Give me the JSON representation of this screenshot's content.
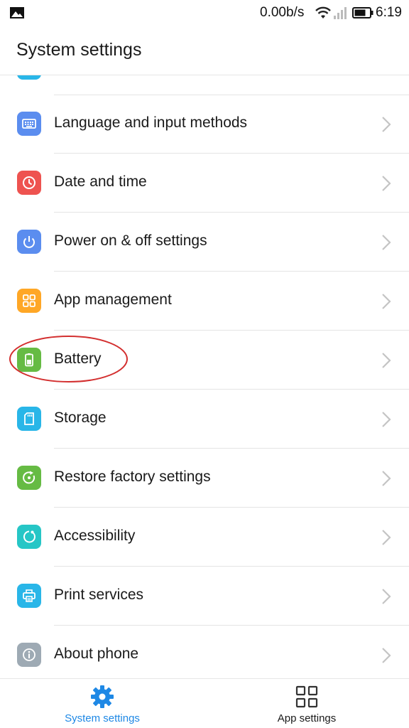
{
  "status_bar": {
    "net_speed": "0.00b/s",
    "time": "6:19"
  },
  "header": {
    "title": "System settings"
  },
  "settings": [
    {
      "label": "Language and input methods",
      "icon": "keyboard-icon",
      "color": "#5b8def"
    },
    {
      "label": "Date and time",
      "icon": "clock-icon",
      "color": "#ee5350"
    },
    {
      "label": "Power on & off settings",
      "icon": "power-icon",
      "color": "#5b8def"
    },
    {
      "label": "App management",
      "icon": "apps-grid-icon",
      "color": "#ffa726"
    },
    {
      "label": "Battery",
      "icon": "battery-icon",
      "color": "#66bb44"
    },
    {
      "label": "Storage",
      "icon": "sd-card-icon",
      "color": "#29b6e8"
    },
    {
      "label": "Restore factory settings",
      "icon": "restore-icon",
      "color": "#66bb44"
    },
    {
      "label": "Accessibility",
      "icon": "accessibility-icon",
      "color": "#26c6c6"
    },
    {
      "label": "Print services",
      "icon": "printer-icon",
      "color": "#29b6e8"
    },
    {
      "label": "About phone",
      "icon": "info-icon",
      "color": "#9eaab4"
    }
  ],
  "bottom_nav": {
    "system_settings_label": "System settings",
    "app_settings_label": "App settings",
    "active_color": "#1e88e5"
  },
  "highlighted_item": "Battery",
  "annotation_color": "#d32f2f"
}
